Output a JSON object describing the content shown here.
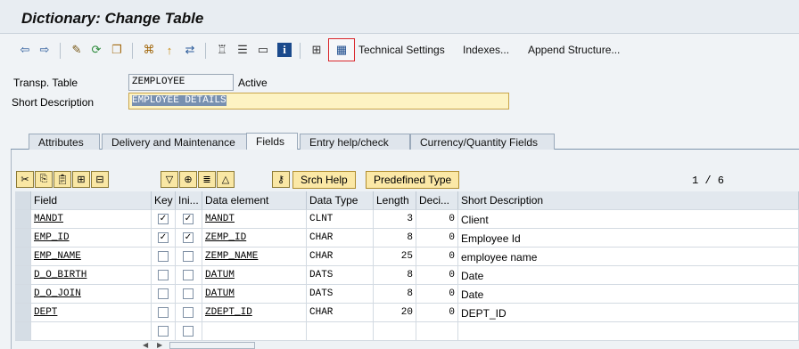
{
  "window": {
    "title": "Dictionary: Change Table"
  },
  "toolbar": {
    "icons": [
      "arrow-left-icon",
      "arrow-right-icon",
      "edit-pen-icon",
      "activate-icon",
      "copy-icon",
      "where-used-icon",
      "info-pin-icon",
      "hierarchy-icon",
      "tree-icon",
      "list-icon",
      "display-icon",
      "info-icon",
      "table-structure-icon",
      "grid-icon"
    ],
    "technical_settings": "Technical Settings",
    "indexes": "Indexes...",
    "append_structure": "Append Structure..."
  },
  "header": {
    "transp_table_label": "Transp. Table",
    "transp_table_value": "ZEMPLOYEE",
    "status": "Active",
    "short_desc_label": "Short Description",
    "short_desc_value": "EMPLOYEE DETAILS"
  },
  "tabs": [
    "Attributes",
    "Delivery and Maintenance",
    "Fields",
    "Entry help/check",
    "Currency/Quantity Fields"
  ],
  "active_tab": "Fields",
  "fields_toolbar": {
    "srch_help": "Srch Help",
    "predefined_type": "Predefined Type",
    "counter": "1 / 6"
  },
  "table": {
    "columns": [
      "Field",
      "Key",
      "Ini...",
      "Data element",
      "Data Type",
      "Length",
      "Deci...",
      "Short Description"
    ],
    "rows": [
      {
        "field": "MANDT",
        "key": true,
        "ini": true,
        "data_element": "MANDT",
        "data_type": "CLNT",
        "length": "3",
        "deci": "0",
        "desc": "Client"
      },
      {
        "field": "EMP_ID",
        "key": true,
        "ini": true,
        "data_element": "ZEMP_ID",
        "data_type": "CHAR",
        "length": "8",
        "deci": "0",
        "desc": "Employee Id"
      },
      {
        "field": "EMP_NAME",
        "key": false,
        "ini": false,
        "data_element": "ZEMP_NAME",
        "data_type": "CHAR",
        "length": "25",
        "deci": "0",
        "desc": "employee name"
      },
      {
        "field": "D_O_BIRTH",
        "key": false,
        "ini": false,
        "data_element": "DATUM",
        "data_type": "DATS",
        "length": "8",
        "deci": "0",
        "desc": "Date"
      },
      {
        "field": "D_O_JOIN",
        "key": false,
        "ini": false,
        "data_element": "DATUM",
        "data_type": "DATS",
        "length": "8",
        "deci": "0",
        "desc": "Date"
      },
      {
        "field": "DEPT",
        "key": false,
        "ini": false,
        "data_element": "ZDEPT_ID",
        "data_type": "CHAR",
        "length": "20",
        "deci": "0",
        "desc": "DEPT_ID"
      },
      {
        "field": "",
        "key": false,
        "ini": false,
        "data_element": "",
        "data_type": "",
        "length": "",
        "deci": "",
        "desc": ""
      }
    ]
  }
}
